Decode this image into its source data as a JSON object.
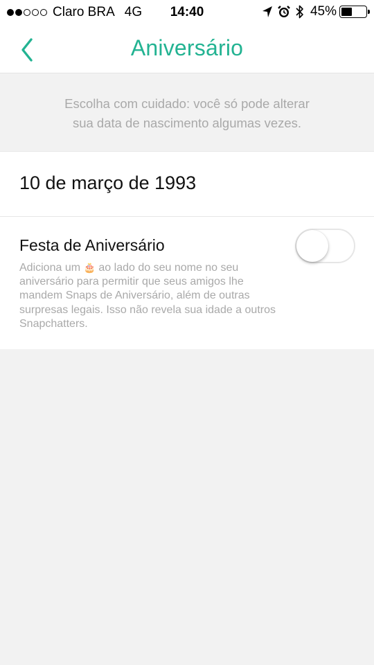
{
  "status_bar": {
    "signal_dots_filled": 2,
    "signal_dots_total": 5,
    "carrier": "Claro BRA",
    "network": "4G",
    "time": "14:40",
    "icons": [
      "location-arrow-icon",
      "alarm-icon",
      "bluetooth-icon"
    ],
    "battery_percent": "45%",
    "battery_level": 0.45
  },
  "nav": {
    "back_icon": "chevron-left-icon",
    "title": "Aniversário",
    "accent_color": "#23b392"
  },
  "hint": {
    "line1": "Escolha com cuidado: você só pode alterar",
    "line2": "sua data de nascimento algumas vezes."
  },
  "birthday": {
    "date": "10 de março de 1993"
  },
  "party": {
    "title": "Festa de Aniversário",
    "desc_before_icon": "Adiciona um",
    "desc_icon": "birthday-cake-icon",
    "desc_after_icon": "ao lado do seu nome no seu aniversário para permitir que seus amigos lhe mandem Snaps de Aniversário, além de outras surpresas legais. Isso não revela sua idade a outros Snapchatters.",
    "toggle_on": false
  }
}
